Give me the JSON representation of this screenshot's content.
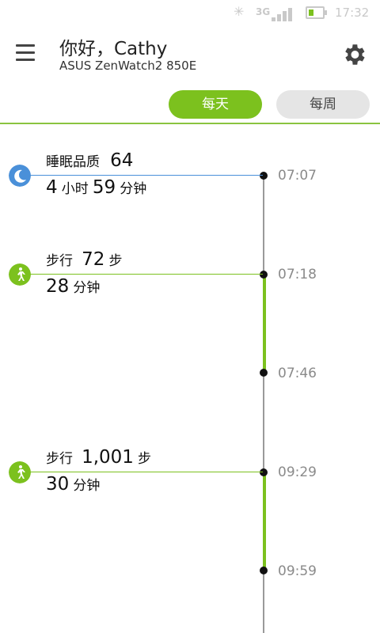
{
  "status_bar": {
    "network": "3G",
    "clock": "17:32",
    "battery_level": 0.3,
    "icons": [
      "bluetooth-icon",
      "signal-icon",
      "battery-icon"
    ]
  },
  "header": {
    "greeting": "你好，Cathy",
    "device": "ASUS ZenWatch2 850E"
  },
  "tabs": {
    "daily": "每天",
    "weekly": "每周",
    "selected": "daily"
  },
  "colors": {
    "accent": "#7cc11e",
    "sleep": "#4a90d9"
  },
  "events": [
    {
      "type": "sleep",
      "icon": "moon-icon",
      "label": "睡眠品质",
      "value": "64",
      "h": "4",
      "h_unit": "小时",
      "m": "59",
      "m_unit": "分钟"
    },
    {
      "type": "walk",
      "icon": "walking-icon",
      "label": "步行",
      "value": "72",
      "unit": "步",
      "m": "28",
      "m_unit": "分钟"
    },
    {
      "type": "walk",
      "icon": "walking-icon",
      "label": "步行",
      "value": "1,001",
      "unit": "步",
      "m": "30",
      "m_unit": "分钟"
    }
  ],
  "times": [
    "07:07",
    "07:18",
    "07:46",
    "09:29",
    "09:59"
  ]
}
